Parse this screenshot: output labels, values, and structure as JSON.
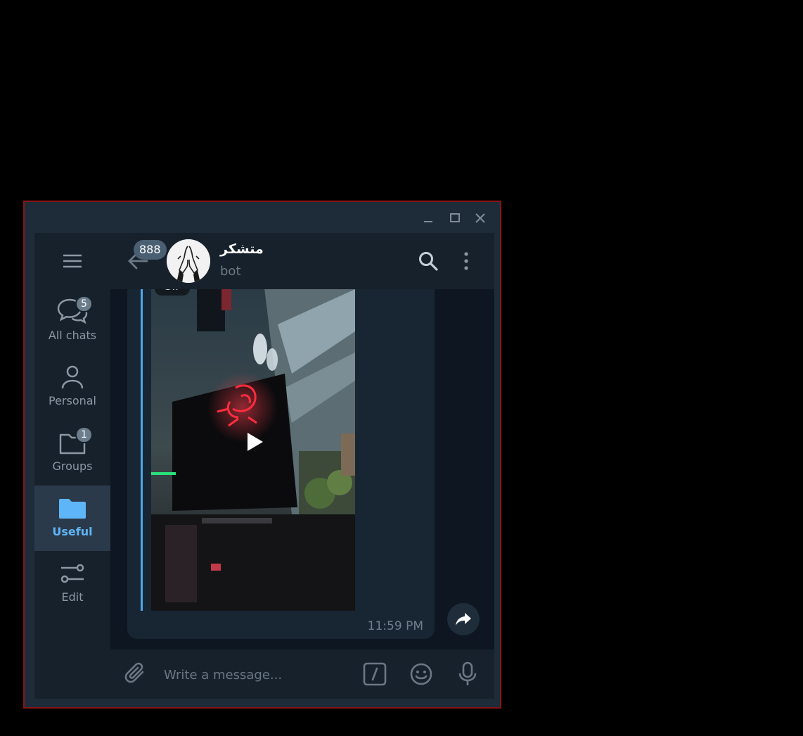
{
  "window": {
    "controls": [
      "minimize-icon",
      "maximize-icon",
      "close-icon"
    ]
  },
  "sidebar": {
    "menu_icon": "hamburger-icon",
    "folders": [
      {
        "label": "All chats",
        "icon": "chats-icon",
        "badge": "5",
        "active": false
      },
      {
        "label": "Personal",
        "icon": "person-icon",
        "badge": "",
        "active": false
      },
      {
        "label": "Groups",
        "icon": "folder-icon",
        "badge": "1",
        "active": false
      },
      {
        "label": "Useful",
        "icon": "folder-filled-icon",
        "badge": "",
        "active": true
      },
      {
        "label": "Edit",
        "icon": "sliders-icon",
        "badge": "",
        "active": false
      }
    ]
  },
  "header": {
    "unread_count": "888",
    "title": "متشکر",
    "subtitle": "bot"
  },
  "message": {
    "media_tag": "GIF",
    "time": "11:59 PM"
  },
  "composer": {
    "placeholder": "Write a message..."
  },
  "colors": {
    "accent": "#5eb5f7",
    "sidebar_bg": "#17212b",
    "chat_bg": "#0e1621",
    "bubble_bg": "#182533",
    "window_border": "#8a1414"
  }
}
